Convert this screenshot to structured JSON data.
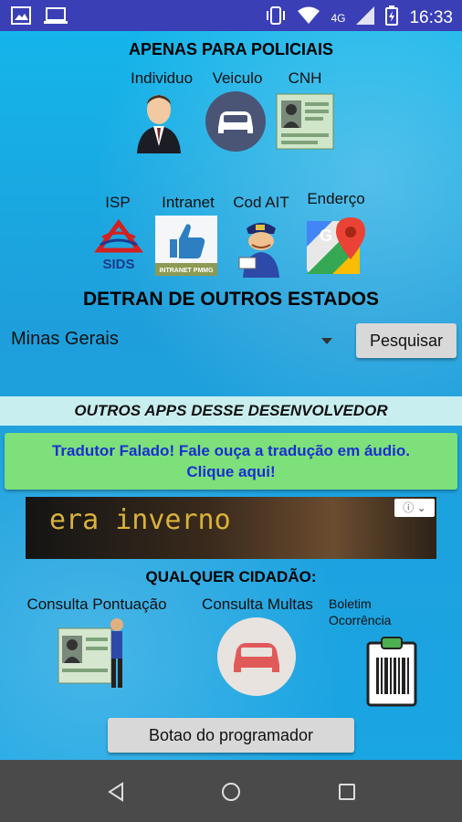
{
  "status_bar": {
    "network": "4G",
    "time": "16:33"
  },
  "police": {
    "title": "APENAS PARA POLICIAIS",
    "items": [
      {
        "label": "Individuo",
        "icon": "person-suit-icon"
      },
      {
        "label": "Veiculo",
        "icon": "car-icon"
      },
      {
        "label": "CNH",
        "icon": "drivers-license-icon"
      },
      {
        "label": "ISP",
        "icon": "sids-logo-icon"
      },
      {
        "label": "Intranet",
        "icon": "thumbs-up-icon"
      },
      {
        "label": "Cod AIT",
        "icon": "police-officer-icon"
      },
      {
        "label": "Enderço",
        "icon": "maps-icon"
      }
    ],
    "sids_text": "SIDS",
    "intranet_text": "INTRANET PMMG"
  },
  "detran": {
    "title": "DETRAN DE OUTROS ESTADOS",
    "selected_state": "Minas Gerais",
    "search_button": "Pesquisar"
  },
  "apps": {
    "title": "OUTROS APPS DESSE DESENVOLVEDOR",
    "promo_line1": "Tradutor Falado! Fale ouça a tradução em áudio.",
    "promo_line2": "Clique aqui!"
  },
  "ad": {
    "text": "era inverno",
    "choices_icon": "info-icon"
  },
  "citizen": {
    "title": "QUALQUER CIDADÃO:",
    "items": [
      {
        "label": "Consulta Pontuação",
        "icon": "license-points-icon"
      },
      {
        "label": "Consulta Multas",
        "icon": "car-icon"
      },
      {
        "label_line1": "Boletim",
        "label_line2": "Ocorrência",
        "icon": "clipboard-icon"
      }
    ]
  },
  "programmer_button": "Botao do programador",
  "colors": {
    "status_bar": "#3a3fb5",
    "background": "#1aa7e0",
    "apps_bar": "#c8eef0",
    "promo": "#7de07a",
    "promo_text": "#1a2fd0",
    "nav_bar": "#4a4a4a"
  }
}
